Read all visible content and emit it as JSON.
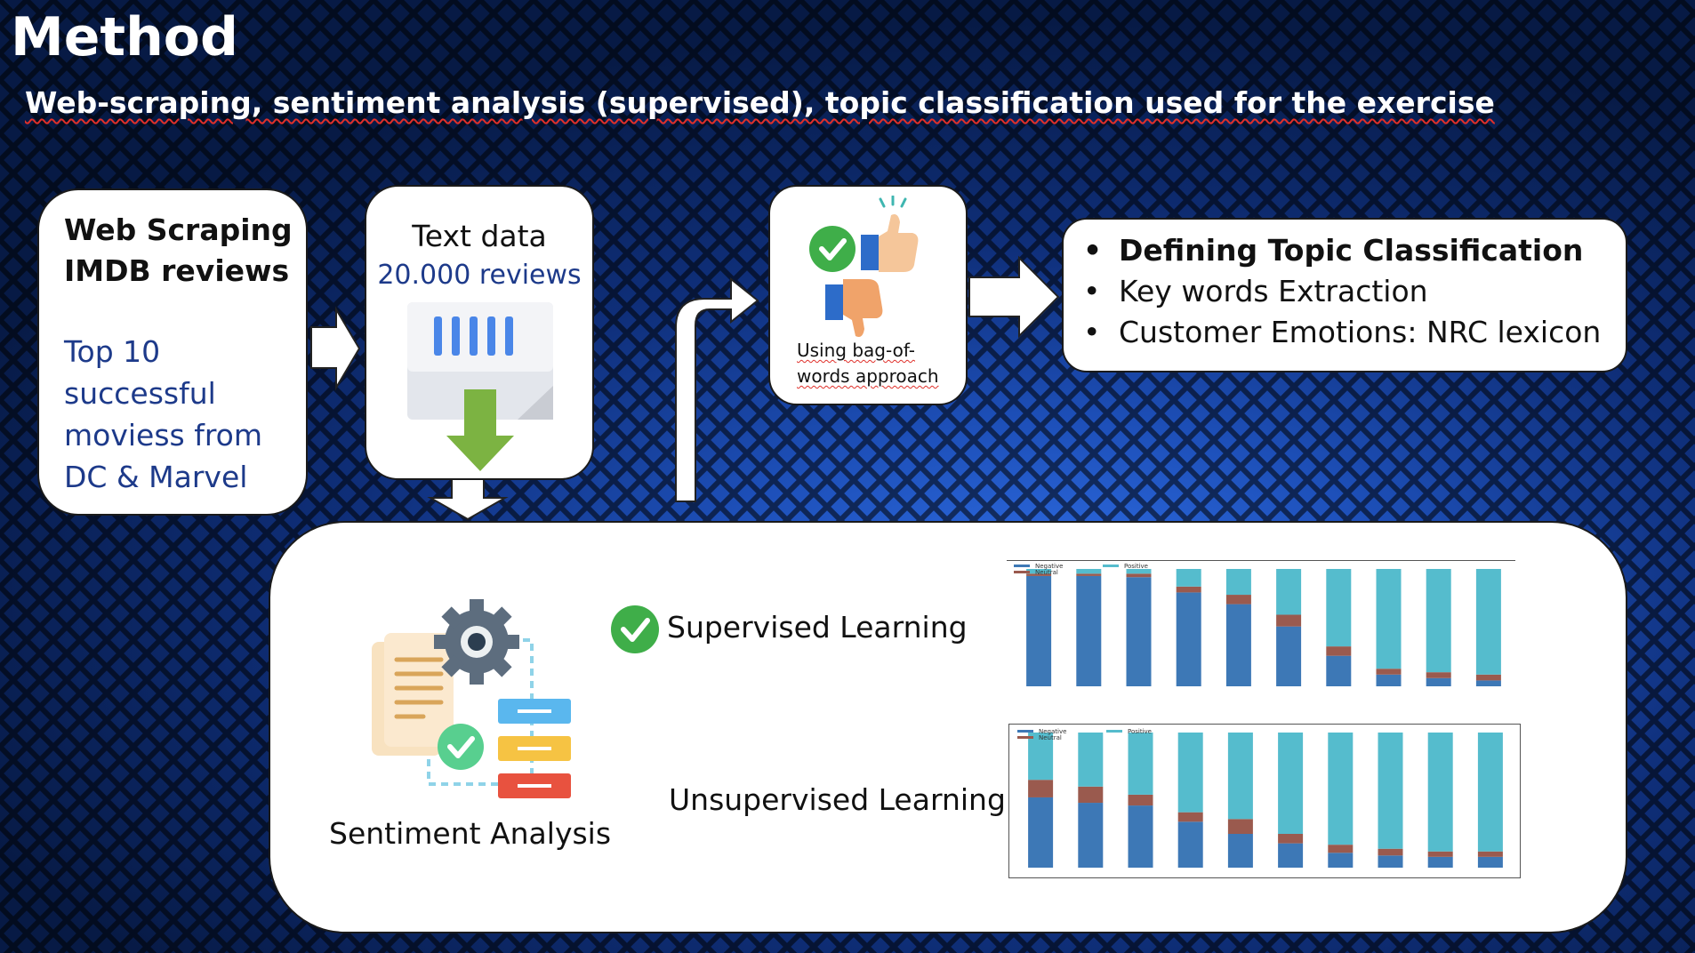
{
  "slide": {
    "title": "Method",
    "subtitle": "Web-scraping, sentiment analysis (supervised), topic classification used for the exercise"
  },
  "box1": {
    "heading_line1": "Web Scraping",
    "heading_line2": "IMDB reviews",
    "body_line1": "Top 10",
    "body_line2": "successful",
    "body_line3": "moviess from",
    "body_line4": "DC & Marvel"
  },
  "box2": {
    "label": "Text data",
    "count": "20.000 reviews"
  },
  "box3": {
    "caption_line1": "Using bag-of-",
    "caption_line2": "words approach"
  },
  "box4": {
    "items": [
      "Defining Topic Classification",
      "Key words Extraction",
      "Customer Emotions: NRC lexicon"
    ]
  },
  "bottom": {
    "sentiment_label": "Sentiment Analysis",
    "supervised_label": "Supervised Learning",
    "unsupervised_label": "Unsupervised Learning"
  },
  "colors": {
    "negative": "#3d78b6",
    "neutral": "#9a5a4e",
    "positive": "#55bccd",
    "check_green": "#3fae49",
    "arrow_green": "#7cb342"
  },
  "icons": {
    "thumbs": "thumbs-up-down-icon",
    "document": "document-download-icon",
    "sentiment": "sentiment-analysis-icon",
    "check": "check-circle-icon"
  },
  "chart_data": [
    {
      "type": "bar",
      "stacked": true,
      "legend": [
        "Negative",
        "Neutral",
        "Positive"
      ],
      "legend_position": "top-left",
      "series": [
        {
          "name": "Negative",
          "values": [
            0.94,
            0.94,
            0.93,
            0.8,
            0.7,
            0.51,
            0.26,
            0.1,
            0.07,
            0.05
          ]
        },
        {
          "name": "Neutral",
          "values": [
            0.02,
            0.02,
            0.03,
            0.05,
            0.08,
            0.1,
            0.08,
            0.05,
            0.05,
            0.05
          ]
        },
        {
          "name": "Positive",
          "values": [
            0.04,
            0.04,
            0.04,
            0.15,
            0.22,
            0.39,
            0.66,
            0.85,
            0.88,
            0.9
          ]
        }
      ]
    },
    {
      "type": "bar",
      "stacked": true,
      "legend": [
        "Negative",
        "Neutral",
        "Positive"
      ],
      "legend_position": "top-left",
      "series": [
        {
          "name": "Negative",
          "values": [
            0.52,
            0.48,
            0.46,
            0.34,
            0.25,
            0.18,
            0.11,
            0.09,
            0.08,
            0.08
          ]
        },
        {
          "name": "Neutral",
          "values": [
            0.13,
            0.12,
            0.08,
            0.07,
            0.11,
            0.07,
            0.06,
            0.05,
            0.04,
            0.04
          ]
        },
        {
          "name": "Positive",
          "values": [
            0.35,
            0.4,
            0.46,
            0.59,
            0.64,
            0.75,
            0.83,
            0.86,
            0.88,
            0.88
          ]
        }
      ]
    }
  ]
}
